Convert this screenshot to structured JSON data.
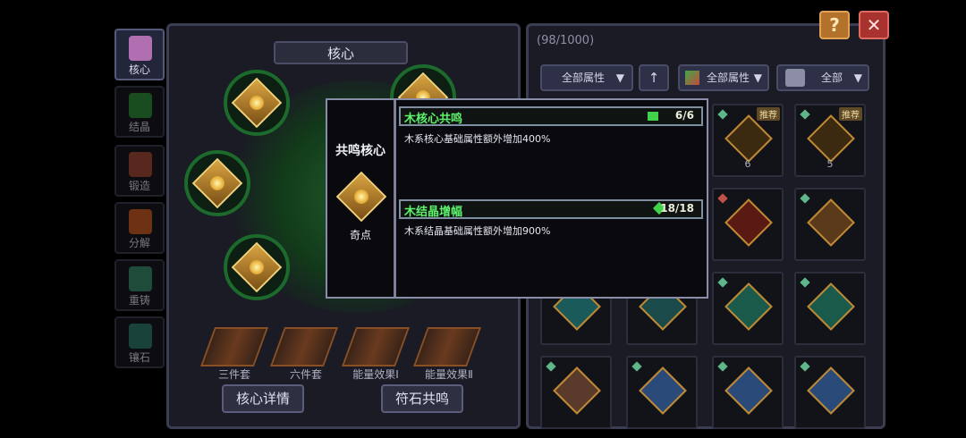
{
  "nav": {
    "items": [
      {
        "label": "核心",
        "active": true
      },
      {
        "label": "结晶",
        "active": false
      },
      {
        "label": "锻造",
        "active": false
      },
      {
        "label": "分解",
        "active": false
      },
      {
        "label": "重铸",
        "active": false
      },
      {
        "label": "镶石",
        "active": false
      }
    ]
  },
  "core_panel": {
    "title": "核心",
    "set_labels": [
      "三件套",
      "六件套",
      "能量效果Ⅰ",
      "能量效果Ⅱ"
    ],
    "detail_button": "核心详情",
    "resonance_button": "符石共鸣"
  },
  "inventory": {
    "count": "(98/1000)",
    "filter_attr": "全部属性",
    "filter_elem": "全部属性",
    "filter_type": "全部",
    "badge_label": "推荐",
    "cell_numbers": [
      "6",
      "5"
    ]
  },
  "popup": {
    "title": "共鸣核心",
    "node_label": "奇点",
    "sections": [
      {
        "title": "木核心共鸣",
        "count": "6/6",
        "desc": "木系核心基础属性额外增加400%"
      },
      {
        "title": "木结晶增幅",
        "count": "18/18",
        "desc": "木系结晶基础属性额外增加900%"
      }
    ]
  },
  "controls": {
    "help": "?",
    "close": "✕"
  },
  "colors": {
    "accent_green": "#5df26a",
    "gold": "#d9a441",
    "panel": "#1a1b24"
  }
}
